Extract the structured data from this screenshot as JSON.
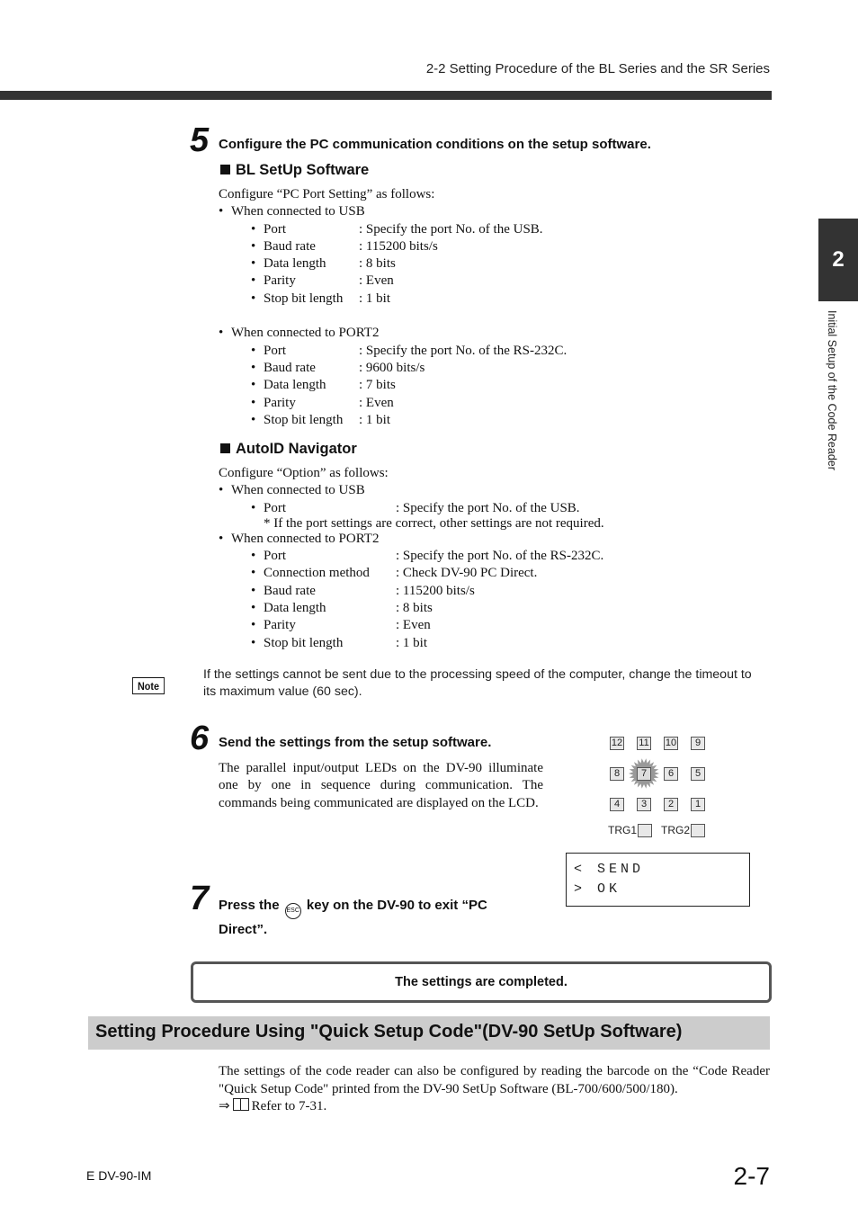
{
  "header": {
    "running_title": "2-2  Setting Procedure of the BL Series and the SR Series"
  },
  "chapter_tab": {
    "number": "2",
    "side_label": "Initial Setup of the Code Reader"
  },
  "step5": {
    "number": "5",
    "title": "Configure the PC communication conditions on the setup software.",
    "bl_setup": {
      "heading": "BL SetUp Software",
      "intro": "Configure “PC Port Setting” as follows:",
      "usb": {
        "label": "When connected to USB",
        "items": [
          {
            "name": "Port",
            "value": ": Specify the port No. of the USB."
          },
          {
            "name": "Baud rate",
            "value": ": 115200 bits/s"
          },
          {
            "name": "Data length",
            "value": ": 8 bits"
          },
          {
            "name": "Parity",
            "value": ": Even"
          },
          {
            "name": "Stop bit length",
            "value": ": 1 bit"
          }
        ]
      },
      "port2": {
        "label": "When connected to PORT2",
        "items": [
          {
            "name": "Port",
            "value": ": Specify the port No. of the RS-232C."
          },
          {
            "name": "Baud rate",
            "value": ": 9600 bits/s"
          },
          {
            "name": "Data length",
            "value": ": 7 bits"
          },
          {
            "name": "Parity",
            "value": ": Even"
          },
          {
            "name": "Stop bit length",
            "value": ": 1 bit"
          }
        ]
      }
    },
    "autoid": {
      "heading": "AutoID Navigator",
      "intro": "Configure “Option” as follows:",
      "usb": {
        "label": "When connected to USB",
        "items": [
          {
            "name": "Port",
            "value": ": Specify the port No. of the USB."
          }
        ],
        "footnote": "* If the port settings are correct, other settings are not required."
      },
      "port2": {
        "label": "When connected to PORT2",
        "items": [
          {
            "name": "Port",
            "value": ": Specify the port No. of the RS-232C."
          },
          {
            "name": "Connection method",
            "value": ": Check DV-90 PC Direct."
          },
          {
            "name": "Baud rate",
            "value": ": 115200 bits/s"
          },
          {
            "name": "Data length",
            "value": ": 8 bits"
          },
          {
            "name": "Parity",
            "value": ": Even"
          },
          {
            "name": "Stop bit length",
            "value": ": 1 bit"
          }
        ]
      }
    }
  },
  "note": {
    "badge": "Note",
    "text": "If the settings cannot be sent due to the processing speed of the computer, change the timeout to its maximum value (60 sec)."
  },
  "step6": {
    "number": "6",
    "title": "Send the settings from the setup software.",
    "body": "The parallel input/output LEDs on the DV-90 illuminate one by one in sequence during communication. The commands being communicated are displayed on the LCD."
  },
  "led_panel": {
    "rows": [
      [
        "12",
        "11",
        "10",
        "9"
      ],
      [
        "8",
        "7",
        "6",
        "5"
      ],
      [
        "4",
        "3",
        "2",
        "1"
      ]
    ],
    "lit_led": "7",
    "trg1": "TRG1",
    "trg2": "TRG2"
  },
  "lcd": {
    "line1": "< SEND",
    "line2": "> OK"
  },
  "step7": {
    "number": "7",
    "title_before": "Press the",
    "key_label": "ESC",
    "title_after": "key on the DV-90 to exit “PC Direct”."
  },
  "completion": {
    "text": "The settings are completed."
  },
  "section": {
    "title": "Setting Procedure Using \"Quick Setup Code\"(DV-90 SetUp Software)",
    "body": "The settings of the code reader can also be configured by reading the barcode on the “Code Reader \"Quick Setup Code\" printed from the DV-90 SetUp Software (BL-700/600/500/180).",
    "ref_arrow": "⇒",
    "ref_text": "Refer to 7-31."
  },
  "footer": {
    "doc_code": "E DV-90-IM",
    "page_number": "2-7"
  }
}
